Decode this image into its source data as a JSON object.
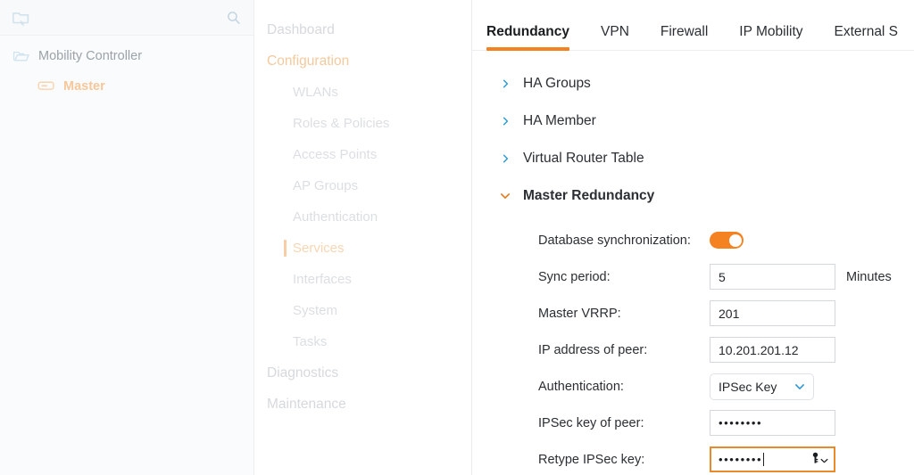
{
  "device_panel": {
    "toolbar": {
      "folder_icon": "folder-cursor-icon",
      "search_icon": "search-icon"
    },
    "tree": [
      {
        "label": "Mobility Controller",
        "icon": "folder-open-icon",
        "level": 0,
        "selected": false
      },
      {
        "label": "Master",
        "icon": "controller-device-icon",
        "level": 1,
        "selected": true
      }
    ]
  },
  "nav": {
    "items": [
      {
        "label": "Dashboard",
        "level": 0,
        "state": "normal"
      },
      {
        "label": "Configuration",
        "level": 0,
        "state": "accent"
      },
      {
        "label": "WLANs",
        "level": 1,
        "state": "normal"
      },
      {
        "label": "Roles & Policies",
        "level": 1,
        "state": "normal"
      },
      {
        "label": "Access Points",
        "level": 1,
        "state": "normal"
      },
      {
        "label": "AP Groups",
        "level": 1,
        "state": "normal"
      },
      {
        "label": "Authentication",
        "level": 1,
        "state": "normal"
      },
      {
        "label": "Services",
        "level": 1,
        "state": "active"
      },
      {
        "label": "Interfaces",
        "level": 1,
        "state": "normal"
      },
      {
        "label": "System",
        "level": 1,
        "state": "normal"
      },
      {
        "label": "Tasks",
        "level": 1,
        "state": "normal"
      },
      {
        "label": "Diagnostics",
        "level": 0,
        "state": "normal"
      },
      {
        "label": "Maintenance",
        "level": 0,
        "state": "normal"
      }
    ]
  },
  "main": {
    "tabs": [
      {
        "label": "Redundancy",
        "active": true
      },
      {
        "label": "VPN",
        "active": false
      },
      {
        "label": "Firewall",
        "active": false
      },
      {
        "label": "IP Mobility",
        "active": false
      },
      {
        "label": "External S",
        "active": false
      }
    ],
    "sections": [
      {
        "label": "HA Groups",
        "expanded": false
      },
      {
        "label": "HA Member",
        "expanded": false
      },
      {
        "label": "Virtual Router Table",
        "expanded": false
      },
      {
        "label": "Master Redundancy",
        "expanded": true
      }
    ],
    "master_redundancy": {
      "database_sync": {
        "label": "Database synchronization:",
        "enabled": true
      },
      "sync_period": {
        "label": "Sync period:",
        "value": "5",
        "unit": "Minutes"
      },
      "master_vrrp": {
        "label": "Master VRRP:",
        "value": "201"
      },
      "peer_ip": {
        "label": "IP address of peer:",
        "value": "10.201.201.12"
      },
      "authentication": {
        "label": "Authentication:",
        "value": "IPSec Key",
        "options": [
          "IPSec Key"
        ]
      },
      "ipsec_key": {
        "label": "IPSec key of peer:",
        "value": "••••••••"
      },
      "retype_ipsec_key": {
        "label": "Retype IPSec key:",
        "value": "••••••••",
        "focused": true,
        "affordance_icon": "key-icon"
      }
    }
  },
  "colors": {
    "accent_orange": "#f58220",
    "chevron_blue": "#2f9ad6",
    "focus_border": "#e88a2a",
    "nav_muted": "#d6d9dc",
    "panel_bg": "#fafbfc"
  }
}
